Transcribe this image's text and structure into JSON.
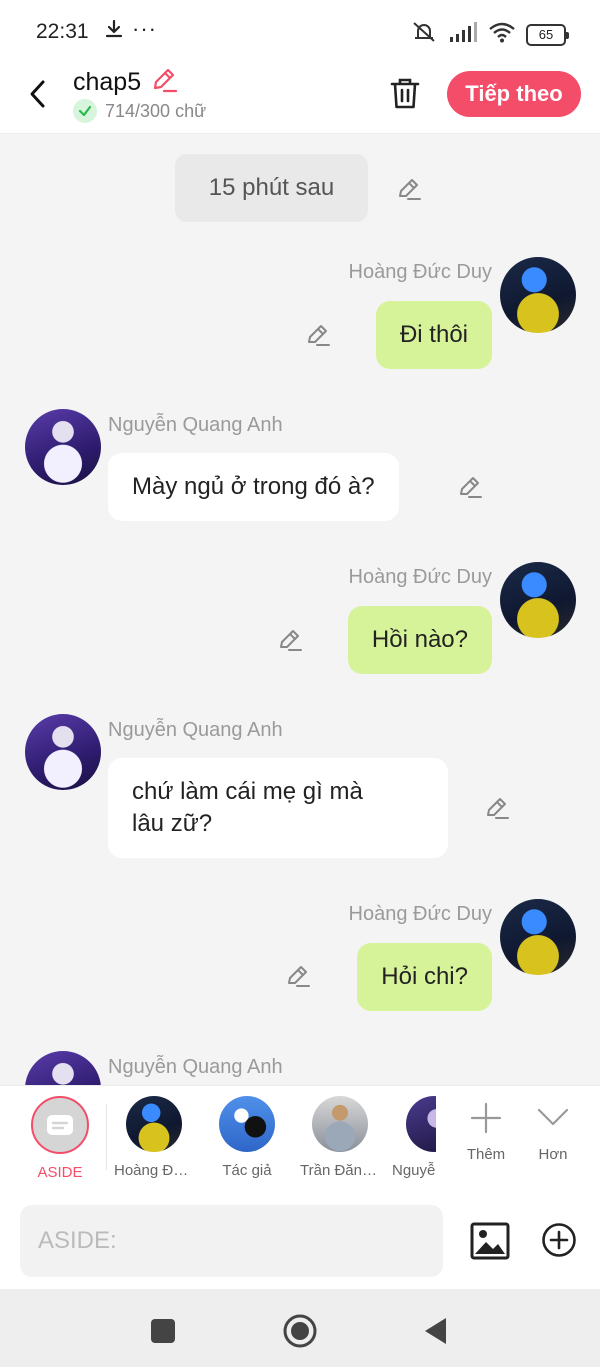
{
  "status_bar": {
    "time": "22:31",
    "battery": "65"
  },
  "header": {
    "title": "chap5",
    "word_count": "714/300 chữ",
    "next_label": "Tiếp theo"
  },
  "chat": {
    "aside_text": "15 phút sau",
    "messages": [
      {
        "sender": "Hoàng Đức Duy",
        "text": "Đi thôi"
      },
      {
        "sender": "Nguyễn Quang Anh",
        "text": "Mày ngủ ở trong đó à?"
      },
      {
        "sender": "Hoàng Đức Duy",
        "text": "Hồi nào?"
      },
      {
        "sender": "Nguyễn Quang Anh",
        "text_line1": "chứ làm cái mẹ gì mà",
        "text_line2": "lâu zữ?"
      },
      {
        "sender": "Hoàng Đức Duy",
        "text": "Hỏi chi?"
      },
      {
        "sender": "Nguyễn Quang Anh"
      }
    ]
  },
  "characters": {
    "aside_label": "ASIDE",
    "items": [
      {
        "label": "Hoàng Đứ..."
      },
      {
        "label": "Tác giả"
      },
      {
        "label": "Trần Đăng..."
      },
      {
        "label": "Nguyễ"
      }
    ],
    "more_label": "Thêm",
    "less_label": "Hơn"
  },
  "input": {
    "placeholder": "ASIDE:"
  },
  "colors": {
    "accent": "#f34d69",
    "my_bubble": "#d7f39a",
    "other_bubble": "#ffffff",
    "background": "#f4f4f5"
  }
}
